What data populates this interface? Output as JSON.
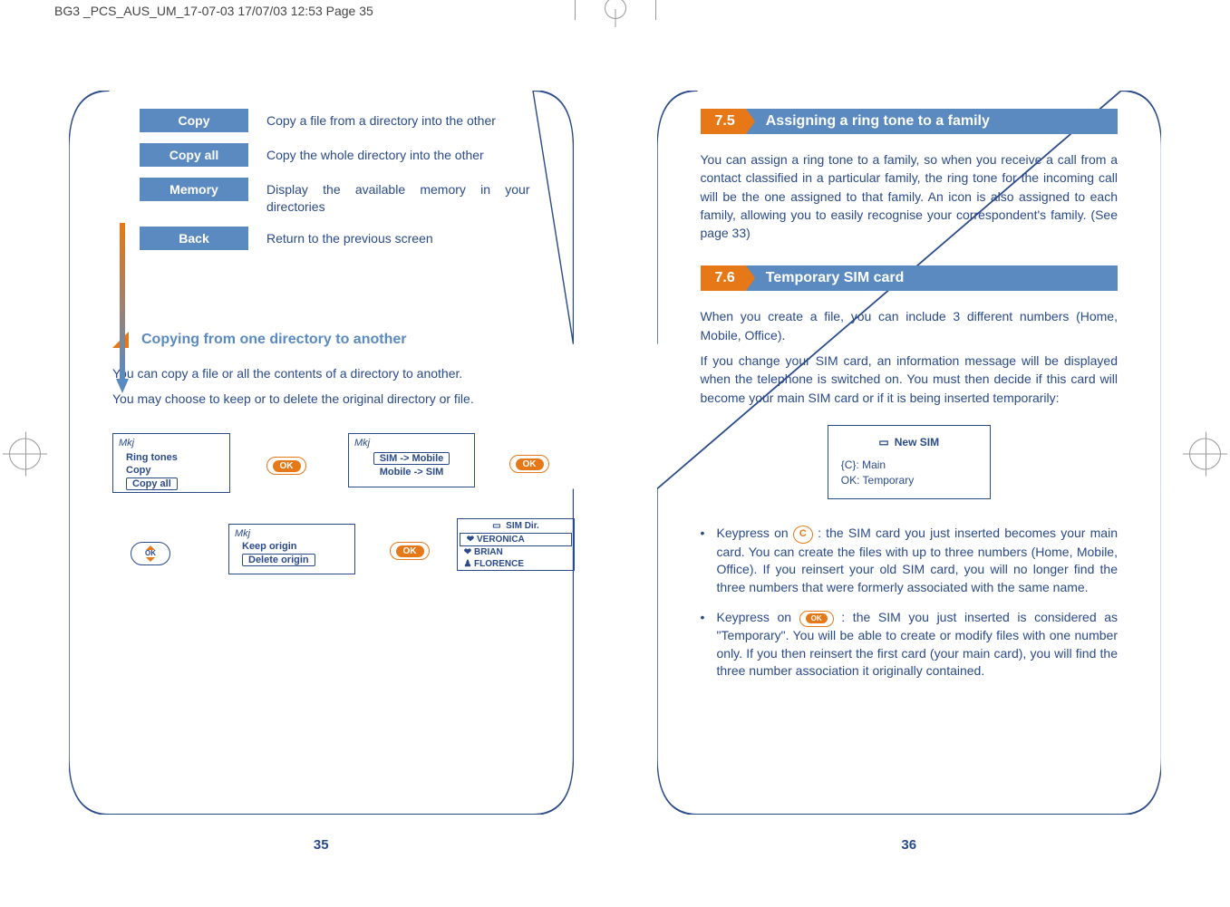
{
  "header": "BG3 _PCS_AUS_UM_17-07-03  17/07/03  12:53  Page 35",
  "left": {
    "defs": [
      {
        "label": "Copy",
        "text": "Copy a file from a directory into the other"
      },
      {
        "label": "Copy all",
        "text": "Copy the whole directory into the other"
      },
      {
        "label": "Memory",
        "text": "Display the available memory in your directories"
      },
      {
        "label": "Back",
        "text": "Return to the previous screen"
      }
    ],
    "section_title": "Copying from one directory to another",
    "para1": "You can copy a file or all the contents of a directory to another.",
    "para2": "You may choose to keep or to delete the original directory or file.",
    "screen1": {
      "l1": "Ring tones",
      "l2": "Copy",
      "l3": "Copy all"
    },
    "screen2": {
      "l1": "SIM -> Mobile",
      "l2": "Mobile -> SIM"
    },
    "screen3": {
      "l1": "Keep origin",
      "l2": "Delete origin"
    },
    "screen4": {
      "title": "SIM Dir.",
      "r1": "VERONICA",
      "r2": "BRIAN",
      "r3": "FLORENCE"
    },
    "ok": "OK",
    "mkj": "Mkj",
    "page_num": "35"
  },
  "right": {
    "sec75_num": "7.5",
    "sec75_title": "Assigning a ring tone to a family",
    "sec75_body": "You can assign a ring tone to a family, so when you receive a call from a contact classified in a particular family, the ring tone for the incoming call will be the one assigned to that family.  An icon is also assigned to each family, allowing you to easily recognise your correspondent's family. (See page 33)",
    "sec76_num": "7.6",
    "sec76_title": "Temporary SIM card",
    "sec76_p1": "When you create a file, you can include 3 different numbers (Home, Mobile, Office).",
    "sec76_p2": "If you change your SIM card, an information message will be displayed when the telephone is switched on. You must then decide if this card will become your main SIM card or if it is being inserted temporarily:",
    "popup": {
      "l1": "New SIM",
      "l2": "{C}:  Main",
      "l3": "OK:  Temporary"
    },
    "bullet1_lead": "Keypress on ",
    "bullet1_tail": ": the SIM card you just inserted becomes your main card. You can create the files with up to three numbers (Home, Mobile, Office). If you reinsert your old SIM card, you will no longer find the three numbers that were formerly associated with the same name.",
    "bullet2_lead": "Keypress on ",
    "bullet2_tail": " : the SIM you just inserted is considered as \"Temporary\". You will be able to create or modify files with one number  only.  If you then reinsert the first card (your main card), you will find the three number association it originally contained.",
    "c_key": "C",
    "ok": "OK",
    "page_num": "36"
  }
}
